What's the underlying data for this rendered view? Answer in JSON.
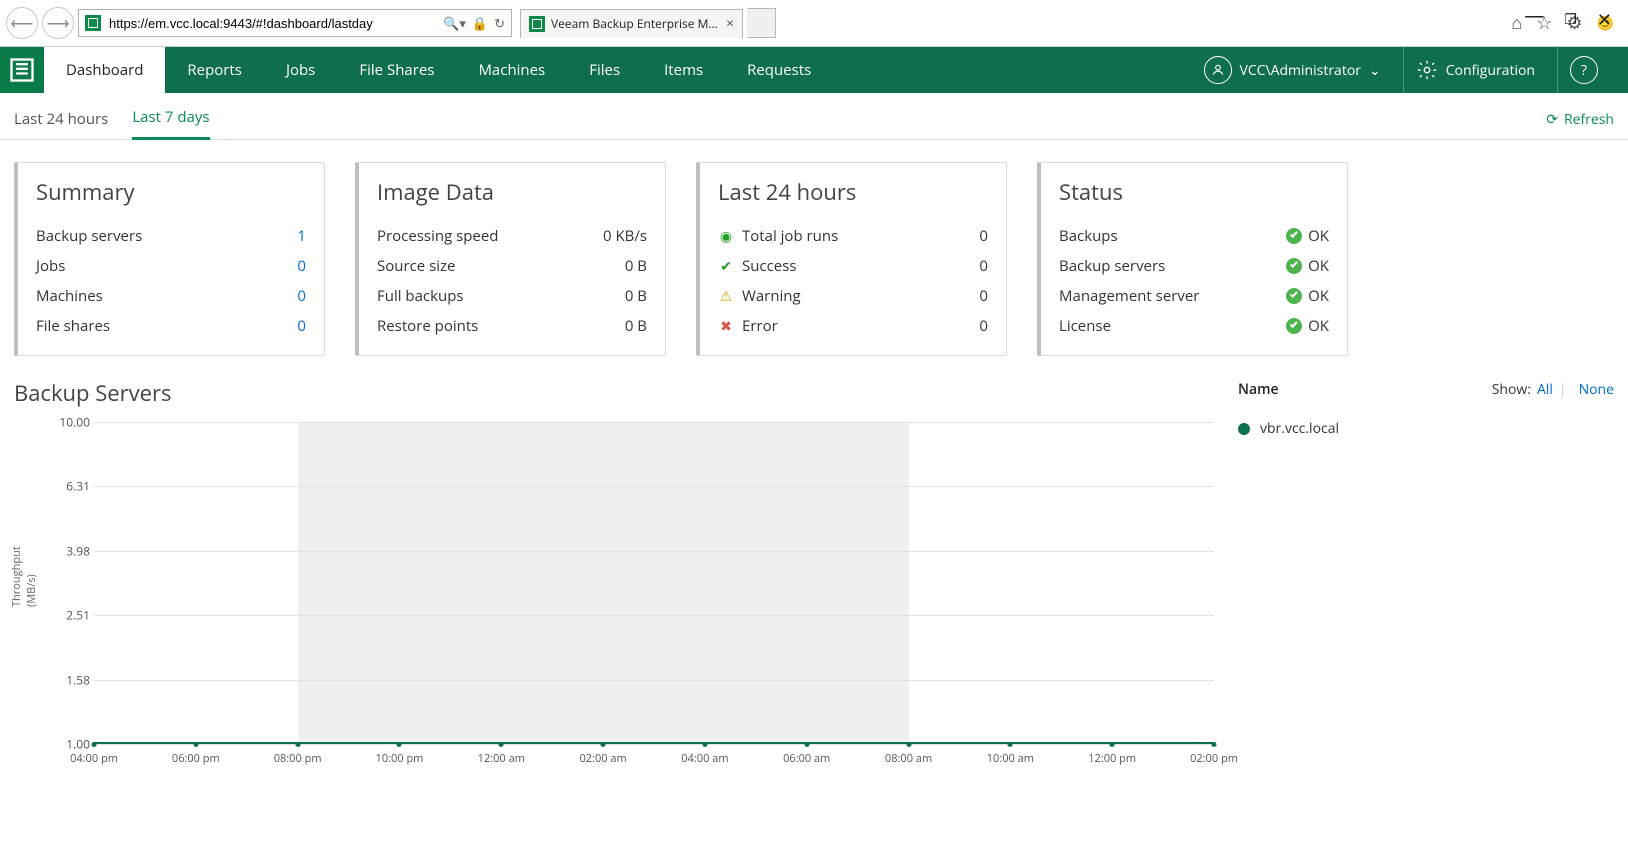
{
  "browser": {
    "url": "https://em.vcc.local:9443/#!dashboard/lastday",
    "tab_title": "Veeam Backup Enterprise M..."
  },
  "nav": {
    "items": [
      "Dashboard",
      "Reports",
      "Jobs",
      "File Shares",
      "Machines",
      "Files",
      "Items",
      "Requests"
    ],
    "active_index": 0,
    "user": "VCC\\Administrator",
    "configuration": "Configuration"
  },
  "subtabs": {
    "items": [
      "Last 24 hours",
      "Last 7 days"
    ],
    "active_index": 1,
    "refresh": "Refresh"
  },
  "cards": {
    "summary": {
      "title": "Summary",
      "rows": [
        {
          "label": "Backup servers",
          "value": "1"
        },
        {
          "label": "Jobs",
          "value": "0"
        },
        {
          "label": "Machines",
          "value": "0"
        },
        {
          "label": "File shares",
          "value": "0"
        }
      ]
    },
    "image_data": {
      "title": "Image Data",
      "rows": [
        {
          "label": "Processing speed",
          "value": "0 KB/s"
        },
        {
          "label": "Source size",
          "value": "0 B"
        },
        {
          "label": "Full backups",
          "value": "0 B"
        },
        {
          "label": "Restore points",
          "value": "0 B"
        }
      ]
    },
    "last24": {
      "title": "Last 24 hours",
      "rows": [
        {
          "icon": "play",
          "label": "Total job runs",
          "value": "0"
        },
        {
          "icon": "ok",
          "label": "Success",
          "value": "0"
        },
        {
          "icon": "warn",
          "label": "Warning",
          "value": "0"
        },
        {
          "icon": "err",
          "label": "Error",
          "value": "0"
        }
      ]
    },
    "status": {
      "title": "Status",
      "rows": [
        {
          "label": "Backups",
          "value": "OK"
        },
        {
          "label": "Backup servers",
          "value": "OK",
          "link": true
        },
        {
          "label": "Management server",
          "value": "OK"
        },
        {
          "label": "License",
          "value": "OK"
        }
      ]
    }
  },
  "chart": {
    "title": "Backup Servers",
    "ylabel": "Throughput (MB/s)"
  },
  "legend": {
    "name_header": "Name",
    "show_label": "Show:",
    "all": "All",
    "none": "None",
    "items": [
      {
        "name": "vbr.vcc.local",
        "color": "#0d7150"
      }
    ]
  },
  "chart_data": {
    "type": "line",
    "title": "Backup Servers",
    "xlabel": "",
    "ylabel": "Throughput (MB/s)",
    "ylim": [
      1.0,
      10.0
    ],
    "y_ticks": [
      1.0,
      1.58,
      2.51,
      3.98,
      6.31,
      10.0
    ],
    "x_ticks": [
      "04:00 pm",
      "06:00 pm",
      "08:00 pm",
      "10:00 pm",
      "12:00 am",
      "02:00 am",
      "04:00 am",
      "06:00 am",
      "08:00 am",
      "10:00 am",
      "12:00 pm",
      "02:00 pm"
    ],
    "night_band": {
      "start": "08:00 pm",
      "end": "08:00 am"
    },
    "series": [
      {
        "name": "vbr.vcc.local",
        "values": [
          1.0,
          1.0,
          1.0,
          1.0,
          1.0,
          1.0,
          1.0,
          1.0,
          1.0,
          1.0,
          1.0,
          1.0
        ]
      }
    ]
  }
}
